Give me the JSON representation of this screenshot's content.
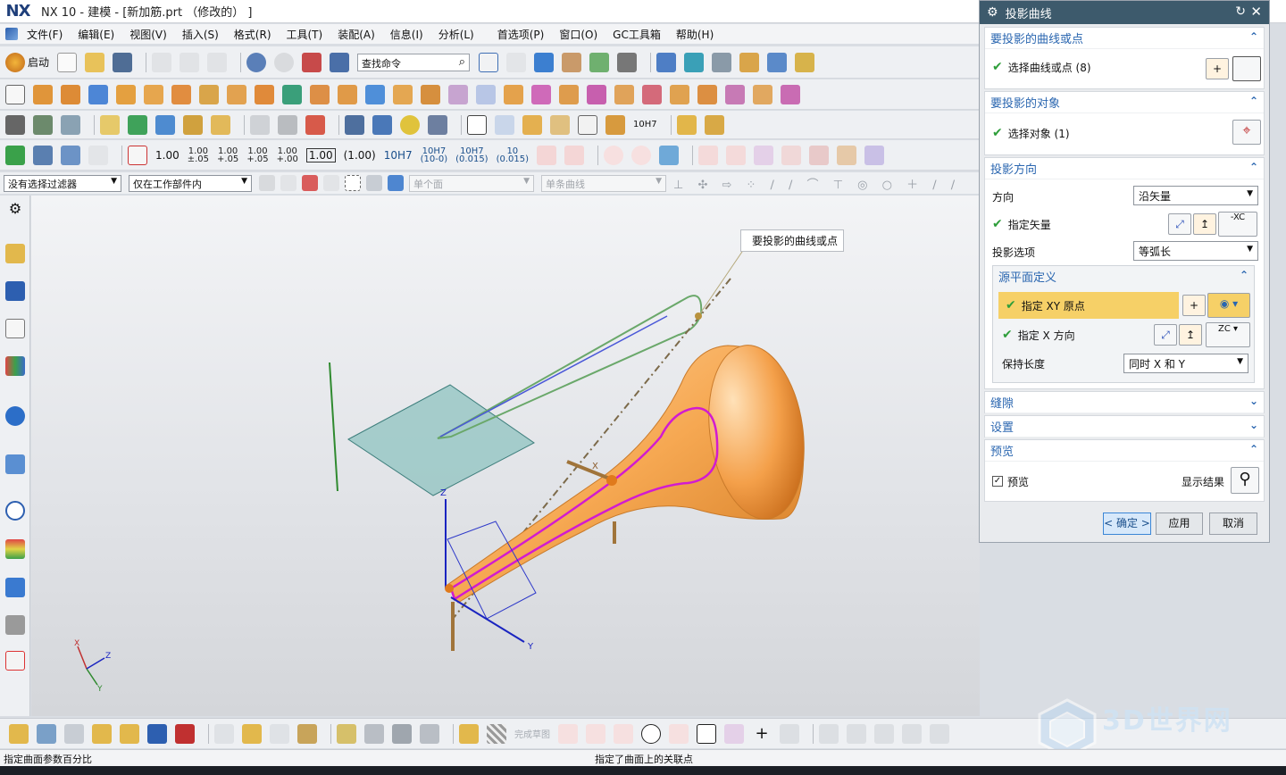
{
  "window": {
    "logo": "NX",
    "title": "NX 10 - 建模 - [新加筋.prt （修改的） ]"
  },
  "menubar": {
    "items": [
      "文件(F)",
      "编辑(E)",
      "视图(V)",
      "插入(S)",
      "格式(R)",
      "工具(T)",
      "装配(A)",
      "信息(I)",
      "分析(L)",
      "首选项(P)",
      "窗口(O)",
      "GC工具箱",
      "帮助(H)"
    ]
  },
  "toolbar1": {
    "start_label": "启动",
    "search_placeholder": "查找命令"
  },
  "toolbar4": {
    "dims": [
      "1.00",
      "1.00",
      "1.00",
      "1.00",
      "1.00",
      "1.00",
      "(1.00)",
      "10H7"
    ],
    "tolerances": [
      "±.05",
      "+.05\n-.02",
      "+.05\n-.00",
      "+.00\n-.02"
    ],
    "fits": [
      "10H7\n(10-0)",
      "10H7\n(0.015)",
      "10\n(0.015)"
    ],
    "gdt_label": "10H7"
  },
  "filterbar": {
    "type_filter": "没有选择过滤器",
    "scope_filter": "仅在工作部件内",
    "face_rule": "单个面",
    "curve_rule": "单条曲线"
  },
  "viewport": {
    "tooltip": "要投影的曲线或点",
    "axis_labels": {
      "x": "X",
      "y": "Y",
      "z": "Z"
    },
    "triad_labels": {
      "x": "X",
      "y": "Y",
      "z": "Z"
    }
  },
  "dialog": {
    "title": "投影曲线",
    "curves_group": {
      "header": "要投影的曲线或点",
      "select_label": "选择曲线或点 (8)"
    },
    "object_group": {
      "header": "要投影的对象",
      "select_label": "选择对象 (1)"
    },
    "direction_group": {
      "header": "投影方向",
      "direction_label": "方向",
      "direction_value": "沿矢量",
      "vector_label": "指定矢量",
      "vector_button": "-XC",
      "option_label": "投影选项",
      "option_value": "等弧长"
    },
    "source_plane": {
      "header": "源平面定义",
      "origin_label": "指定 XY 原点",
      "xdir_label": "指定 X 方向",
      "xdir_button": "ZC",
      "keep_length_label": "保持长度",
      "keep_length_value": "同时 X 和 Y"
    },
    "gap_group": {
      "header": "缝隙"
    },
    "settings_group": {
      "header": "设置"
    },
    "preview_group": {
      "header": "预览",
      "preview_label": "预览",
      "preview_checked": true,
      "show_result_label": "显示结果"
    },
    "buttons": {
      "ok": "< 确定 >",
      "apply": "应用",
      "cancel": "取消"
    }
  },
  "bottombar": {
    "finish_sketch": "完成草图"
  },
  "statusbar": {
    "left": "指定曲面参数百分比",
    "middle": "指定了曲面上的关联点"
  },
  "watermark": {
    "text": "3D世界网"
  },
  "colors": {
    "accent": "#2a66b0",
    "dialog_title": "#3d5a6c",
    "highlight": "#f6d067",
    "check": "#2e9e3a",
    "horn": "#f0a04a",
    "sketch_plane": "#8fc3c0",
    "magenta_curve": "#d21bd0"
  }
}
